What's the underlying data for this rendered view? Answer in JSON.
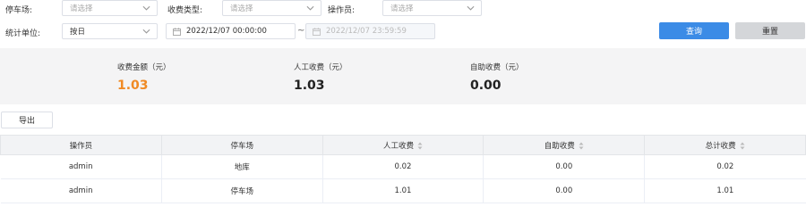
{
  "filters": {
    "parking_lot": {
      "label": "停车场:",
      "placeholder": "请选择"
    },
    "fee_type": {
      "label": "收费类型:",
      "placeholder": "请选择"
    },
    "operator": {
      "label": "操作员:",
      "placeholder": "请选择"
    },
    "unit": {
      "label": "统计单位:",
      "value": "按日"
    },
    "start_time": "2022/12/07 00:00:00",
    "range_sep": "~",
    "end_time": "2022/12/07 23:59:59"
  },
  "buttons": {
    "query": "查询",
    "reset": "重置",
    "export": "导出"
  },
  "summary": {
    "total": {
      "label": "收费金额（元）",
      "value": "1.03"
    },
    "manual": {
      "label": "人工收费（元）",
      "value": "1.03"
    },
    "auto": {
      "label": "自助收费（元）",
      "value": "0.00"
    }
  },
  "table": {
    "columns": [
      "操作员",
      "停车场",
      "人工收费",
      "自助收费",
      "总计收费"
    ],
    "rows": [
      [
        "admin",
        "地库",
        "0.02",
        "0.00",
        "0.02"
      ],
      [
        "admin",
        "停车场",
        "1.01",
        "0.00",
        "1.01"
      ]
    ]
  },
  "colors": {
    "primary": "#3b8be6",
    "highlight": "#f08a24",
    "panel": "#f4f4f5"
  },
  "icons": {
    "dropdown": "chevron-down-icon",
    "date": "calendar-icon",
    "sort": "sort-icon"
  }
}
